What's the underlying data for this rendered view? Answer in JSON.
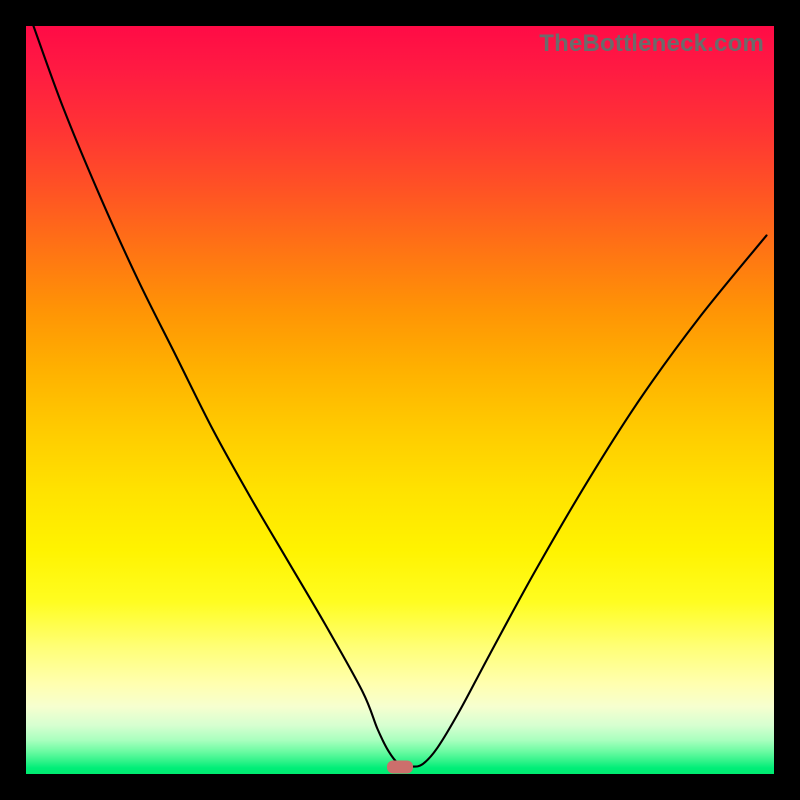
{
  "watermark": "TheBottleneck.com",
  "chart_data": {
    "type": "line",
    "title": "",
    "xlabel": "",
    "ylabel": "",
    "xlim": [
      0,
      100
    ],
    "ylim": [
      0,
      100
    ],
    "grid": false,
    "legend": false,
    "series": [
      {
        "name": "bottleneck-curve",
        "x": [
          1,
          5,
          10,
          15,
          20,
          25,
          30,
          35,
          40,
          45,
          47,
          48.5,
          50,
          51.5,
          53,
          55,
          58,
          62,
          68,
          75,
          82,
          90,
          99
        ],
        "y": [
          100,
          89,
          77,
          66,
          56,
          46,
          37,
          28.5,
          20,
          11,
          6,
          3,
          1.2,
          1.0,
          1.3,
          3.5,
          8.5,
          16,
          27,
          39,
          50,
          61,
          72
        ]
      }
    ],
    "marker": {
      "x": 50,
      "y": 1.0,
      "color": "#cc6f6c"
    },
    "background_gradient": {
      "top": "#ff0b46",
      "bottom": "#00ea70",
      "note": "red (high bottleneck) at top to green (balanced) at bottom"
    }
  }
}
